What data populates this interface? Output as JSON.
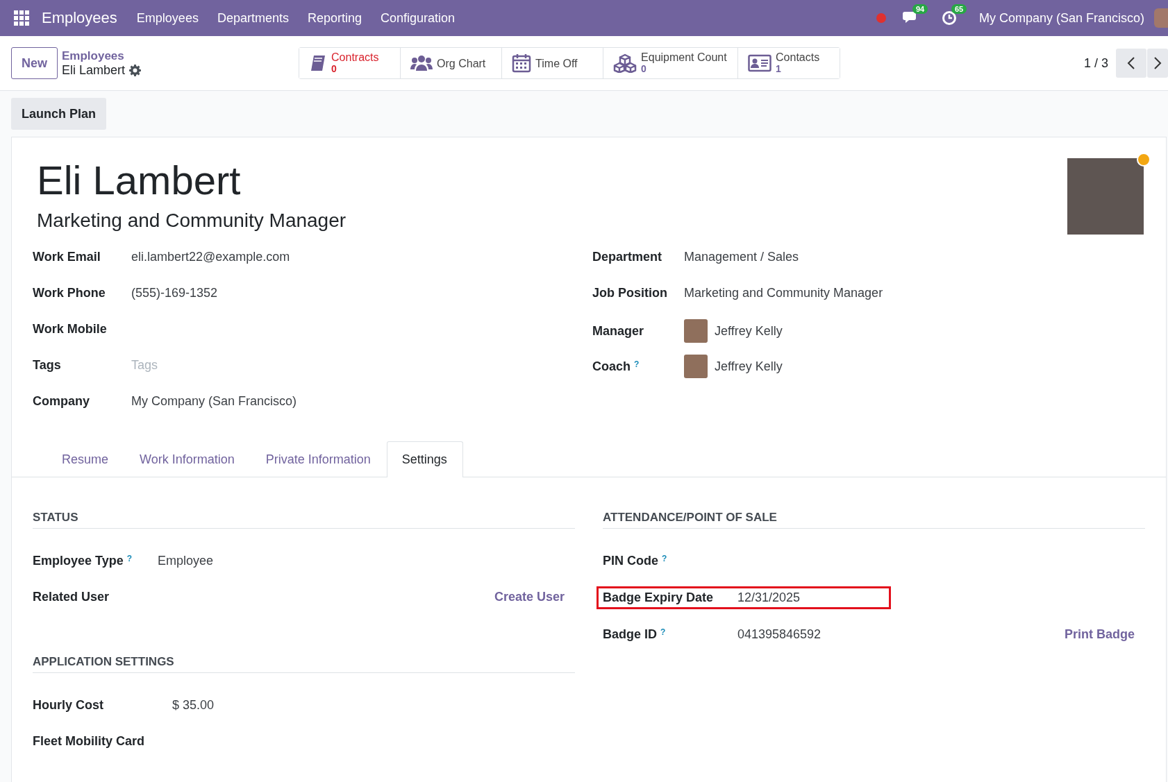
{
  "navbar": {
    "app_name": "Employees",
    "menu": [
      "Employees",
      "Departments",
      "Reporting",
      "Configuration"
    ],
    "messages_count": "94",
    "activities_count": "65",
    "company": "My Company (San Francisco)"
  },
  "control_panel": {
    "new_button": "New",
    "breadcrumb_parent": "Employees",
    "breadcrumb_current": "Eli Lambert",
    "pager": "1 / 3",
    "smart_buttons": [
      {
        "label": "Contracts",
        "value": "0",
        "alert": true
      },
      {
        "label": "Org Chart",
        "alert": false
      },
      {
        "label": "Time Off",
        "alert": false
      },
      {
        "label": "Equipment Count",
        "value": "0",
        "alert": false
      },
      {
        "label": "Contacts",
        "value": "1",
        "alert": false
      }
    ]
  },
  "action_button": "Launch Plan",
  "employee": {
    "name": "Eli Lambert",
    "job_title": "Marketing and Community Manager",
    "online": true,
    "left_fields": [
      {
        "label": "Work Email",
        "value": "eli.lambert22@example.com"
      },
      {
        "label": "Work Phone",
        "value": "(555)-169-1352"
      },
      {
        "label": "Work Mobile"
      },
      {
        "label": "Tags",
        "placeholder": "Tags"
      },
      {
        "label": "Company",
        "value": "My Company (San Francisco)"
      }
    ],
    "right_fields": [
      {
        "label": "Department",
        "value": "Management / Sales",
        "kind": "text"
      },
      {
        "label": "Job Position",
        "value": "Marketing and Community Manager",
        "kind": "text"
      },
      {
        "label": "Manager",
        "value": "Jeffrey Kelly",
        "kind": "person"
      },
      {
        "label": "Coach",
        "help": "?",
        "value": "Jeffrey Kelly",
        "kind": "person"
      }
    ]
  },
  "tabs": [
    {
      "label": "Resume",
      "selected": false
    },
    {
      "label": "Work Information",
      "selected": false
    },
    {
      "label": "Private Information",
      "selected": false
    },
    {
      "label": "Settings",
      "selected": true
    }
  ],
  "settings": {
    "status": {
      "title": "STATUS",
      "fields": [
        {
          "label": "Employee Type",
          "help": "?",
          "value": "Employee"
        },
        {
          "label": "Related User",
          "link": "Create User"
        }
      ]
    },
    "attendance": {
      "title": "ATTENDANCE/POINT OF SALE",
      "fields": [
        {
          "label": "PIN Code",
          "help": "?",
          "highlighted": false
        },
        {
          "label": "Badge Expiry Date",
          "value": "12/31/2025",
          "highlighted": true
        },
        {
          "label": "Badge ID",
          "help": "?",
          "value": "041395846592",
          "link": "Print Badge",
          "highlighted": false
        }
      ]
    },
    "application": {
      "title": "APPLICATION SETTINGS",
      "fields": [
        {
          "label": "Hourly Cost",
          "value": "$ 35.00"
        },
        {
          "label": "Fleet Mobility Card"
        }
      ]
    }
  }
}
